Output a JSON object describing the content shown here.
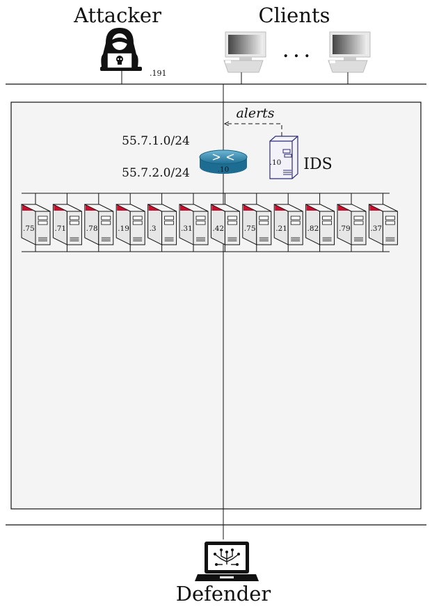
{
  "nodes": {
    "attacker": {
      "label": "Attacker",
      "ip": ".191"
    },
    "clients": {
      "label": "Clients",
      "ellipsis": ". . ."
    },
    "router": {
      "ip": ".10"
    },
    "ids": {
      "label": "IDS",
      "ip": ".10"
    },
    "defender": {
      "label": "Defender"
    }
  },
  "subnets": {
    "upper": "55.7.1.0/24",
    "lower": "55.7.2.0/24"
  },
  "alerts_label": "alerts",
  "servers": [
    ".75",
    ".71",
    ".78",
    ".19",
    ".3",
    ".31",
    ".42",
    ".75",
    ".21",
    ".82",
    ".79",
    ".37"
  ],
  "colors": {
    "server_flag": "#c8102e",
    "ids_outline": "#2a2a7a",
    "router": "#3a8fb5",
    "panel_bg": "#f4f4f4"
  }
}
